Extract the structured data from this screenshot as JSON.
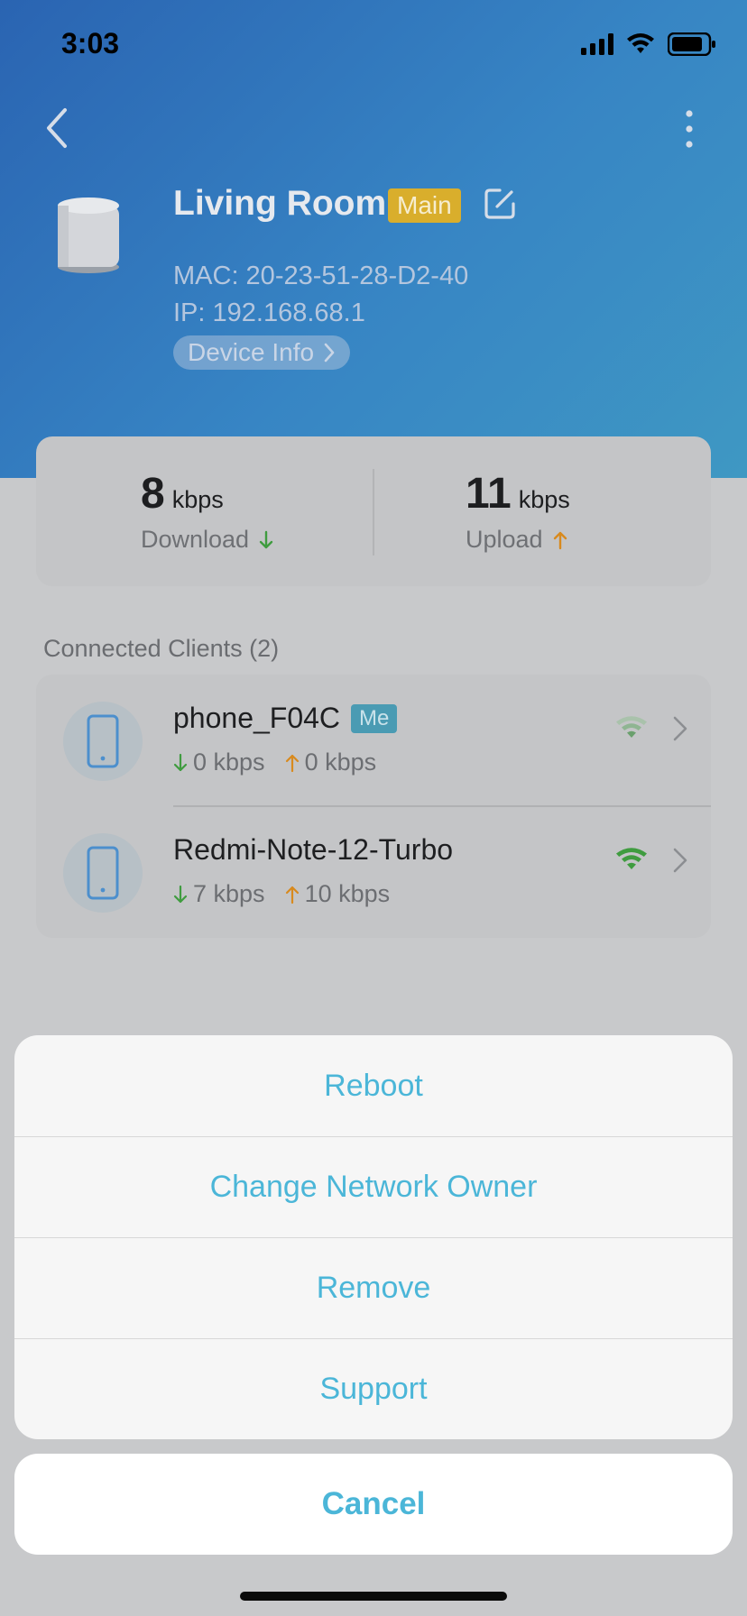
{
  "status": {
    "time": "3:03"
  },
  "device": {
    "name": "Living Room",
    "badge": "Main",
    "mac": "MAC: 20-23-51-28-D2-40",
    "ip": "IP: 192.168.68.1",
    "info_button": "Device Info"
  },
  "speed": {
    "download": {
      "value": "8",
      "unit": "kbps",
      "label": "Download"
    },
    "upload": {
      "value": "11",
      "unit": "kbps",
      "label": "Upload"
    }
  },
  "clients": {
    "title": "Connected Clients (2)",
    "items": [
      {
        "name": "phone_F04C",
        "badge": "Me",
        "down": "0 kbps",
        "up": "0 kbps",
        "signal_color": "#5f9b63"
      },
      {
        "name": "Redmi-Note-12-Turbo",
        "badge": "",
        "down": "7 kbps",
        "up": "10 kbps",
        "signal_color": "#3f9c3f"
      }
    ]
  },
  "action_sheet": {
    "items": [
      "Reboot",
      "Change Network Owner",
      "Remove",
      "Support"
    ],
    "cancel": "Cancel"
  },
  "colors": {
    "accent": "#4bb6d8",
    "download_arrow": "#3f9c3f",
    "upload_arrow": "#d88a1e"
  },
  "icons": {
    "back": "chevron-left-icon",
    "more": "more-vertical-icon",
    "edit": "edit-icon",
    "phone": "phone-icon",
    "wifi": "wifi-icon",
    "chevron": "chevron-right-icon"
  }
}
